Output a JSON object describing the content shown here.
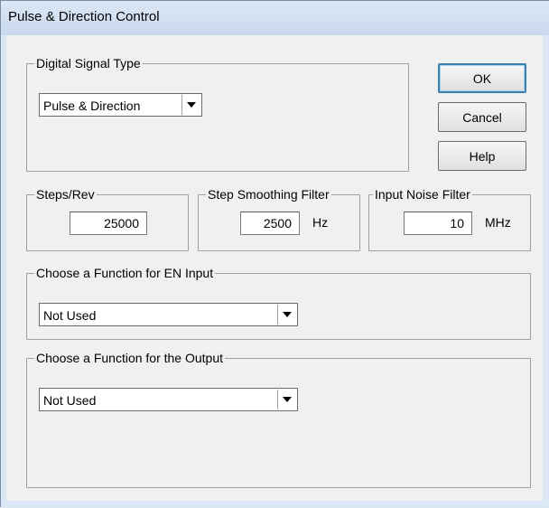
{
  "window": {
    "title": "Pulse & Direction Control"
  },
  "signal_type": {
    "label": "Digital Signal Type",
    "selected": "Pulse & Direction",
    "arrow_icon": "dropdown-arrow"
  },
  "buttons": {
    "ok": "OK",
    "cancel": "Cancel",
    "help": "Help"
  },
  "steps_rev": {
    "label": "Steps/Rev",
    "value": "25000"
  },
  "smoothing": {
    "label": "Step Smoothing Filter",
    "value": "2500",
    "unit": "Hz"
  },
  "noise": {
    "label": "Input Noise Filter",
    "value": "10",
    "unit": "MHz"
  },
  "en_input": {
    "label": "Choose a Function for EN Input",
    "selected": "Not Used"
  },
  "output": {
    "label": "Choose a Function for the Output",
    "selected": "Not Used"
  }
}
